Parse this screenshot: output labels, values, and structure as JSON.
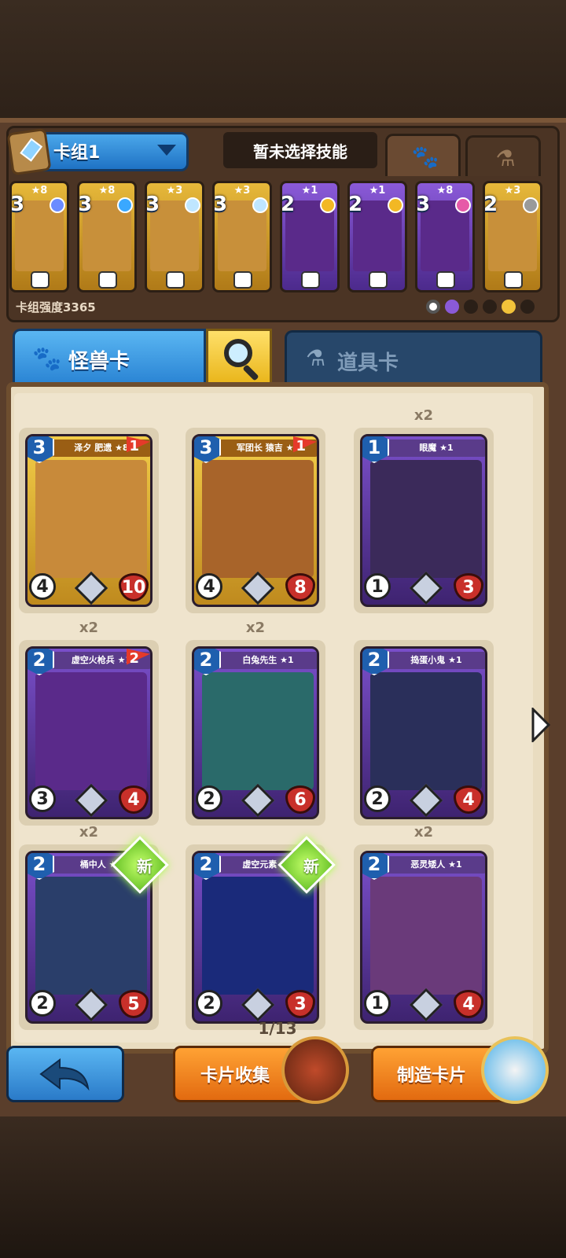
{
  "deck": {
    "name": "卡组1",
    "skill_label": "暂未选择技能",
    "power_label": "卡组强度3365",
    "mini_cards": [
      {
        "stars": "★8",
        "cost": "3",
        "rarity": "gold",
        "gem_color": "#6b8cff"
      },
      {
        "stars": "★8",
        "cost": "3",
        "rarity": "gold",
        "gem_color": "#3aa8ff"
      },
      {
        "stars": "★3",
        "cost": "3",
        "rarity": "gold",
        "gem_color": "#bfe6ff"
      },
      {
        "stars": "★3",
        "cost": "3",
        "rarity": "gold",
        "gem_color": "#bfe6ff"
      },
      {
        "stars": "★1",
        "cost": "2",
        "rarity": "purple",
        "gem_color": "#f2b824"
      },
      {
        "stars": "★1",
        "cost": "2",
        "rarity": "purple",
        "gem_color": "#f2b824"
      },
      {
        "stars": "★8",
        "cost": "3",
        "rarity": "purple",
        "gem_color": "#e65aa8"
      },
      {
        "stars": "★3",
        "cost": "2",
        "rarity": "gold",
        "gem_color": "#9a9a9a"
      }
    ]
  },
  "tabs": {
    "monster_label": "怪兽卡",
    "item_label": "道具卡"
  },
  "cards": [
    {
      "title": "泽夕 肥遗 ★8",
      "cost": "3",
      "attack": "4",
      "health": "10",
      "flag": "1",
      "count": "",
      "rarity": "gold",
      "is_new": false,
      "art_color": "#c88a3a"
    },
    {
      "title": "军团长 猿吉 ★8",
      "cost": "3",
      "attack": "4",
      "health": "8",
      "flag": "1",
      "count": "",
      "rarity": "gold",
      "is_new": false,
      "art_color": "#a8642a"
    },
    {
      "title": "眼魔 ★1",
      "cost": "1",
      "attack": "1",
      "health": "3",
      "flag": "",
      "count": "x2",
      "rarity": "purple",
      "is_new": false,
      "art_color": "#3b2a5a"
    },
    {
      "title": "虚空火枪兵 ★1",
      "cost": "2",
      "attack": "3",
      "health": "4",
      "flag": "2",
      "count": "x2",
      "rarity": "purple",
      "is_new": false,
      "art_color": "#5a2a8a"
    },
    {
      "title": "白兔先生 ★1",
      "cost": "2",
      "attack": "2",
      "health": "6",
      "flag": "",
      "count": "x2",
      "rarity": "purple",
      "is_new": false,
      "art_color": "#2a6a6a"
    },
    {
      "title": "捣蛋小鬼 ★1",
      "cost": "2",
      "attack": "2",
      "health": "4",
      "flag": "",
      "count": "",
      "rarity": "purple",
      "is_new": false,
      "art_color": "#2a2f5a"
    },
    {
      "title": "桶中人 ★1",
      "cost": "2",
      "attack": "2",
      "health": "5",
      "flag": "",
      "count": "x2",
      "rarity": "purple",
      "is_new": true,
      "new_label": "新",
      "art_color": "#2a3e6a"
    },
    {
      "title": "虚空元素 ★1",
      "cost": "2",
      "attack": "2",
      "health": "3",
      "flag": "",
      "count": "",
      "rarity": "purple",
      "is_new": true,
      "new_label": "新",
      "art_color": "#1a2a7a"
    },
    {
      "title": "恶灵矮人 ★1",
      "cost": "2",
      "attack": "1",
      "health": "4",
      "flag": "",
      "count": "x2",
      "rarity": "purple",
      "is_new": false,
      "art_color": "#6a3a7a"
    }
  ],
  "pagination": {
    "label": "1/13"
  },
  "buttons": {
    "collection_label": "卡片收集",
    "craft_label": "制造卡片"
  },
  "colors": {
    "blue_accent": "#2a84d4",
    "orange_accent": "#e26a10",
    "new_green": "#6bc42a",
    "health_red": "#c8302a"
  },
  "icons": [
    "paw-icon",
    "potion-icon",
    "search-icon",
    "back-arrow-icon",
    "dice-icon",
    "next-arrow-icon"
  ]
}
